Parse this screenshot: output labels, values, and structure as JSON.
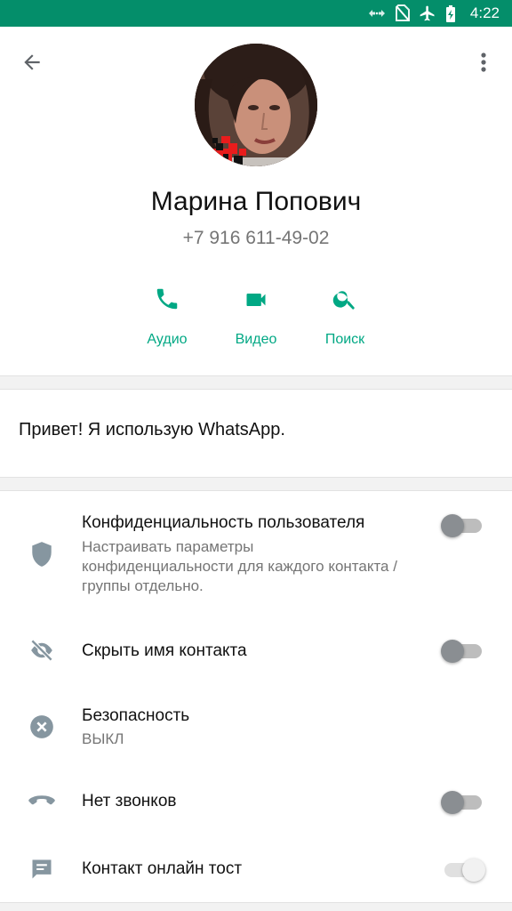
{
  "status_bar": {
    "time": "4:22",
    "icons": [
      "data-arrows-icon",
      "no-sim-icon",
      "airplane-icon",
      "battery-charging-icon"
    ],
    "background": "#048e6a"
  },
  "contact": {
    "name": "Марина Попович",
    "phone": "+7 916 611-49-02"
  },
  "actions": [
    {
      "label": "Аудио",
      "icon": "phone-icon"
    },
    {
      "label": "Видео",
      "icon": "video-icon"
    },
    {
      "label": "Поиск",
      "icon": "search-icon"
    }
  ],
  "about": {
    "text": "Привет! Я использую WhatsApp."
  },
  "settings": [
    {
      "title": "Конфиденциальность пользователя",
      "subtitle": "Настраивать параметры конфиденциальности для каждого контакта / группы отдельно.",
      "icon": "shield-icon",
      "toggle": false
    },
    {
      "title": "Скрыть имя контакта",
      "icon": "eye-off-icon",
      "toggle": false
    },
    {
      "title": "Безопасность",
      "subtitle": "ВЫКЛ",
      "icon": "close-circle-icon"
    },
    {
      "title": "Нет звонков",
      "icon": "call-end-icon",
      "toggle": false
    },
    {
      "title": "Контакт онлайн тост",
      "icon": "message-icon",
      "toggle": true,
      "disabled": true
    }
  ],
  "colors": {
    "accent": "#00a884",
    "icon_gray": "#8696a0",
    "secondary_text": "#757575"
  }
}
